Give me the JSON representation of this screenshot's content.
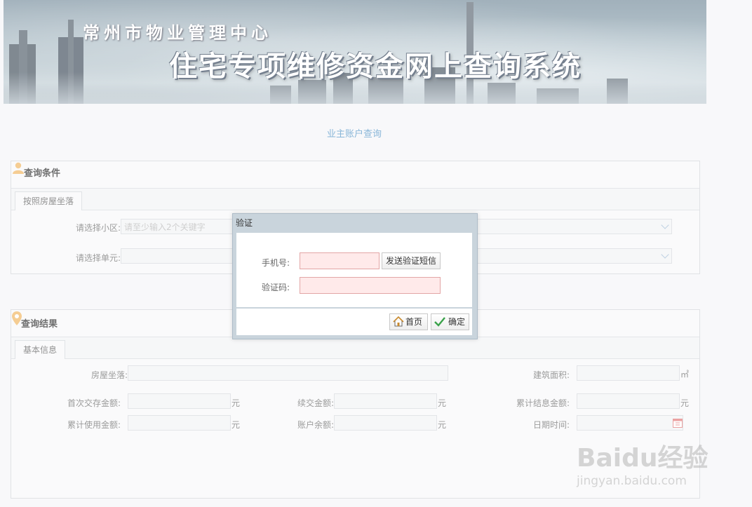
{
  "banner": {
    "subtitle": "常州市物业管理中心",
    "title": "住宅专项维修资金网上查询系统"
  },
  "page_title": "业主账户查询",
  "query_panel": {
    "title": "查询条件",
    "tab": "按照房屋坐落",
    "community_label": "请选择小区:",
    "community_placeholder": "请至少输入2个关键字",
    "unit_label": "请选择单元:"
  },
  "result_panel": {
    "title": "查询结果",
    "tab": "基本信息",
    "fields": {
      "location_label": "房屋坐落:",
      "area_label": "建筑面积:",
      "area_unit": "㎡",
      "first_deposit_label": "首次交存金额:",
      "renewal_label": "续交金额:",
      "accrued_interest_label": "累计结息金额:",
      "used_label": "累计使用金额:",
      "balance_label": "账户余额:",
      "datetime_label": "日期时间:",
      "yuan": "元"
    }
  },
  "dialog": {
    "title": "验证",
    "phone_label": "手机号:",
    "send_sms_button": "发送验证短信",
    "code_label": "验证码:",
    "home_button": "首页",
    "confirm_button": "确定"
  },
  "watermark": {
    "brand": "Baidu经验",
    "url": "jingyan.baidu.com"
  },
  "colors": {
    "accent": "#4a8fc4",
    "invalid_input_bg": "#ffeaea",
    "invalid_input_border": "#e3a6a6"
  }
}
